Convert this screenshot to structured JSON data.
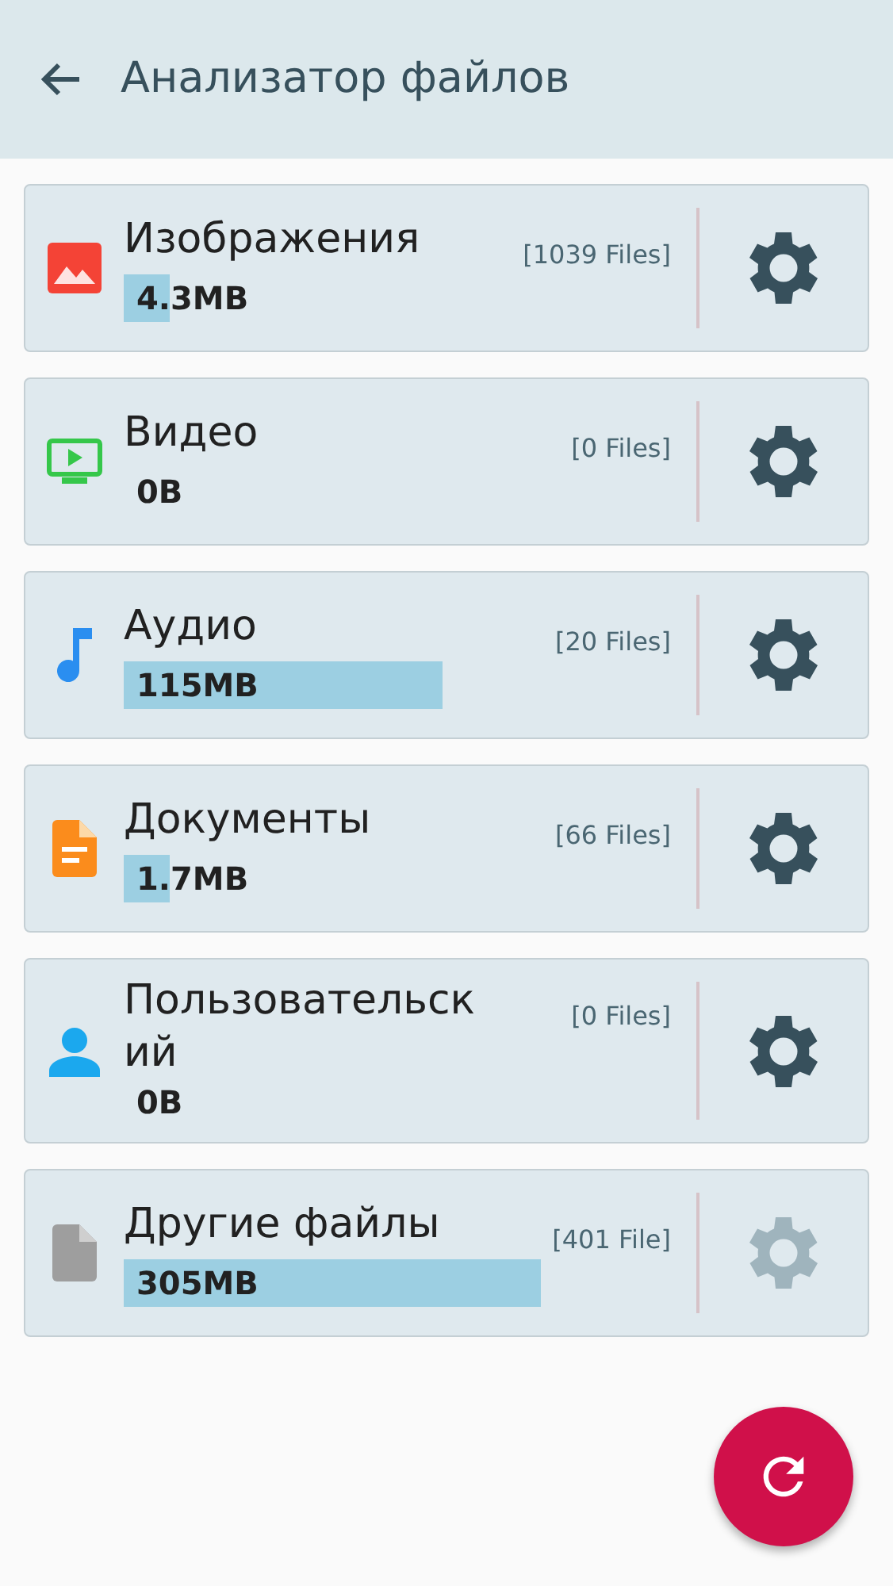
{
  "app_bar": {
    "title": "Анализатор файлов"
  },
  "categories": [
    {
      "kind": "images",
      "title": "Изображения",
      "files": "[1039 Files]",
      "size": "4.3MB",
      "disabled": false
    },
    {
      "kind": "video",
      "title": "Видео",
      "files": "[0 Files]",
      "size": "0B",
      "disabled": false
    },
    {
      "kind": "audio",
      "title": "Аудио",
      "files": "[20 Files]",
      "size": "115MB",
      "disabled": false
    },
    {
      "kind": "documents",
      "title": "Документы",
      "files": "[66 Files]",
      "size": "1.7MB",
      "disabled": false
    },
    {
      "kind": "user",
      "title": "Пользовательский",
      "files": "[0 Files]",
      "size": "0B",
      "disabled": false
    },
    {
      "kind": "other",
      "title": "Другие файлы",
      "files": "[401 File]",
      "size": "305MB",
      "disabled": true
    }
  ]
}
